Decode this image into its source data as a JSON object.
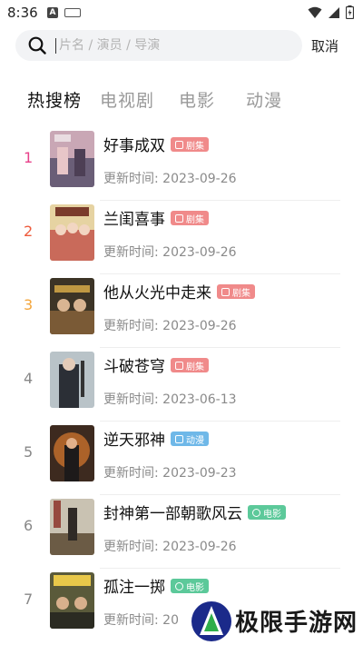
{
  "status_bar": {
    "time": "8:36",
    "notification_icon_letter": "A"
  },
  "search": {
    "placeholder": "片名 / 演员 / 导演",
    "value": "",
    "cancel_label": "取消"
  },
  "tabs": [
    {
      "label": "热搜榜",
      "active": true
    },
    {
      "label": "电视剧",
      "active": false
    },
    {
      "label": "电影",
      "active": false
    },
    {
      "label": "动漫",
      "active": false
    }
  ],
  "updated_prefix": "更新时间: ",
  "items": [
    {
      "rank": "1",
      "rank_color": "#e8418a",
      "title": "好事成双",
      "badge": "剧集",
      "badge_type": "drama",
      "updated": "更新时间: 2023-09-26"
    },
    {
      "rank": "2",
      "rank_color": "#ee5b3c",
      "title": "兰闺喜事",
      "badge": "剧集",
      "badge_type": "drama",
      "updated": "更新时间: 2023-09-26"
    },
    {
      "rank": "3",
      "rank_color": "#f4a63c",
      "title": "他从火光中走来",
      "badge": "剧集",
      "badge_type": "drama",
      "updated": "更新时间: 2023-09-26"
    },
    {
      "rank": "4",
      "rank_color": "#888888",
      "title": "斗破苍穹",
      "badge": "剧集",
      "badge_type": "drama",
      "updated": "更新时间: 2023-06-13"
    },
    {
      "rank": "5",
      "rank_color": "#888888",
      "title": "逆天邪神",
      "badge": "动漫",
      "badge_type": "anime",
      "updated": "更新时间: 2023-09-23"
    },
    {
      "rank": "6",
      "rank_color": "#888888",
      "title": "封神第一部朝歌风云",
      "badge": "电影",
      "badge_type": "movie",
      "updated": "更新时间: 2023-09-26"
    },
    {
      "rank": "7",
      "rank_color": "#888888",
      "title": "孤注一掷",
      "badge": "电影",
      "badge_type": "movie",
      "updated": "更新时间: 20"
    }
  ],
  "watermark": {
    "text": "极限手游网"
  },
  "colors": {
    "badge_drama": "#f08a8a",
    "badge_anime": "#6fb8e8",
    "badge_movie": "#5cc99a"
  }
}
